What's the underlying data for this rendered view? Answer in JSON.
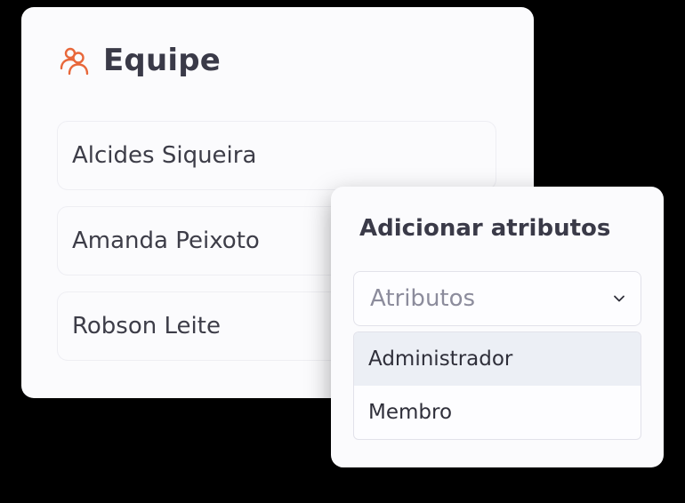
{
  "team": {
    "title": "Equipe",
    "icon": "users-icon",
    "accent_color": "#e8673a",
    "members": [
      {
        "name": "Alcides Siqueira"
      },
      {
        "name": "Amanda Peixoto"
      },
      {
        "name": "Robson Leite"
      }
    ]
  },
  "attributes": {
    "title": "Adicionar atributos",
    "select": {
      "placeholder": "Atributos",
      "icon": "chevron-down-icon"
    },
    "options": [
      {
        "label": "Administrador",
        "highlighted": true
      },
      {
        "label": "Membro",
        "highlighted": false
      }
    ]
  }
}
